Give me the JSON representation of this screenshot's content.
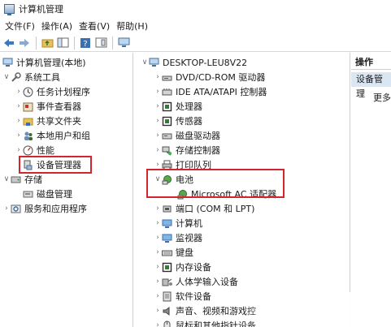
{
  "window": {
    "title": "计算机管理"
  },
  "menu": [
    "文件(F)",
    "操作(A)",
    "查看(V)",
    "帮助(H)"
  ],
  "left_tree": {
    "root": "计算机管理(本地)",
    "system_tools": "系统工具",
    "items": [
      "任务计划程序",
      "事件查看器",
      "共享文件夹",
      "本地用户和组",
      "性能",
      "设备管理器"
    ],
    "storage": "存储",
    "disk_management": "磁盘管理",
    "services": "服务和应用程序"
  },
  "device_tree": {
    "computer": "DESKTOP-LEU8V22",
    "categories_top": [
      "DVD/CD-ROM 驱动器",
      "IDE ATA/ATAPI 控制器",
      "处理器",
      "传感器",
      "磁盘驱动器",
      "存储控制器",
      "打印队列"
    ],
    "battery": {
      "label": "电池",
      "child": "Microsoft AC 适配器"
    },
    "categories_bottom": [
      "端口 (COM 和 LPT)",
      "计算机",
      "监视器",
      "键盘",
      "内存设备",
      "人体学输入设备",
      "软件设备",
      "声音、视频和游戏控",
      "鼠标和其他指针设备"
    ]
  },
  "actions": {
    "header": "操作",
    "selected": "设备管理",
    "more": "更多"
  },
  "colors": {
    "highlight": "#d1262e",
    "selection": "#dbe6f3"
  }
}
